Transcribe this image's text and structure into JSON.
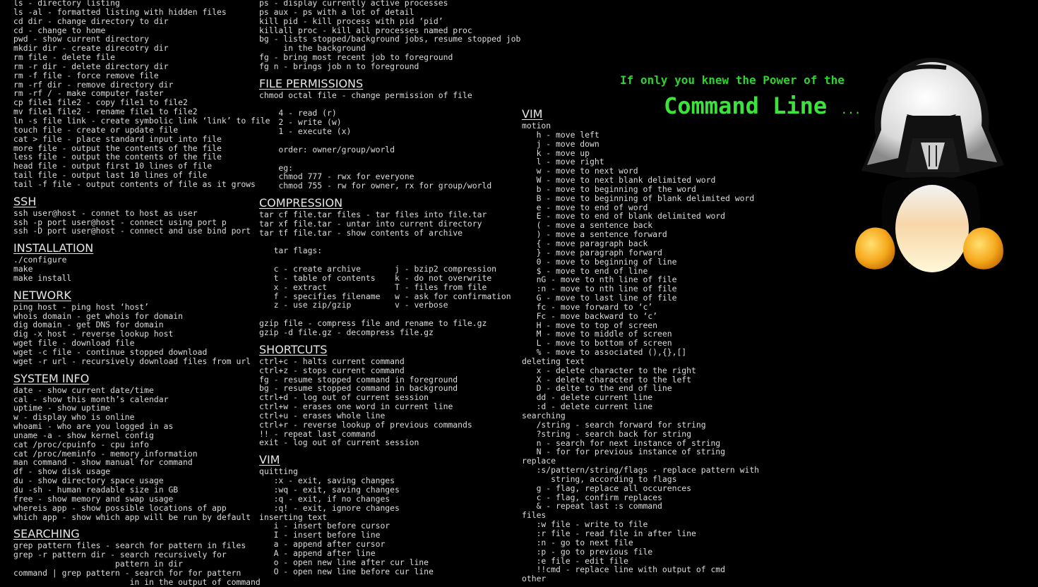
{
  "header": {
    "tagline": "If only you knew the Power of the",
    "title": "Command Line",
    "title_suffix": "..."
  },
  "col1": [
    {
      "kind": "line",
      "text": "ls - directory listing"
    },
    {
      "kind": "line",
      "text": "ls -al - formatted listing with hidden files"
    },
    {
      "kind": "line",
      "text": "cd dir - change directory to dir"
    },
    {
      "kind": "line",
      "text": "cd - change to home"
    },
    {
      "kind": "line",
      "text": "pwd - show current directory"
    },
    {
      "kind": "line",
      "text": "mkdir dir - create direcotry dir"
    },
    {
      "kind": "line",
      "text": "rm file - delete file"
    },
    {
      "kind": "line",
      "text": "rm -r dir - delete directory dir"
    },
    {
      "kind": "line",
      "text": "rm -f file - force remove file"
    },
    {
      "kind": "line",
      "text": "rm -rf dir - remove directory dir"
    },
    {
      "kind": "line",
      "text": "rm -rf / - make computer faster"
    },
    {
      "kind": "line",
      "text": "cp file1 file2 - copy file1 to file2"
    },
    {
      "kind": "line",
      "text": "mv file1 file2 - rename file1 to file2"
    },
    {
      "kind": "line",
      "text": "ln -s file link - create symbolic link ‘link’ to file"
    },
    {
      "kind": "line",
      "text": "touch file - create or update file"
    },
    {
      "kind": "line",
      "text": "cat > file - place standard input into file"
    },
    {
      "kind": "line",
      "text": "more file - output the contents of the file"
    },
    {
      "kind": "line",
      "text": "less file - output the contents of the file"
    },
    {
      "kind": "line",
      "text": "head file - output first 10 lines of file"
    },
    {
      "kind": "line",
      "text": "tail file - output last 10 lines of file"
    },
    {
      "kind": "line",
      "text": "tail -f file - output contents of file as it grows"
    },
    {
      "kind": "head",
      "text": "SSH"
    },
    {
      "kind": "line",
      "text": "ssh user@host - connet to host as user"
    },
    {
      "kind": "line",
      "text": "ssh -p port user@host - connect using port p"
    },
    {
      "kind": "line",
      "text": "ssh -D port user@host - connect and use bind port"
    },
    {
      "kind": "head",
      "text": "INSTALLATION"
    },
    {
      "kind": "line",
      "text": "./configure"
    },
    {
      "kind": "line",
      "text": "make"
    },
    {
      "kind": "line",
      "text": "make install"
    },
    {
      "kind": "head",
      "text": "NETWORK"
    },
    {
      "kind": "line",
      "text": "ping host - ping host ‘host’"
    },
    {
      "kind": "line",
      "text": "whois domain - get whois for domain"
    },
    {
      "kind": "line",
      "text": "dig domain - get DNS for domain"
    },
    {
      "kind": "line",
      "text": "dig -x host - reverse lookup host"
    },
    {
      "kind": "line",
      "text": "wget file - download file"
    },
    {
      "kind": "line",
      "text": "wget -c file - continue stopped download"
    },
    {
      "kind": "line",
      "text": "wget -r url - recursively download files from url"
    },
    {
      "kind": "head",
      "text": "SYSTEM INFO"
    },
    {
      "kind": "line",
      "text": "date - show current date/time"
    },
    {
      "kind": "line",
      "text": "cal - show this month’s calendar"
    },
    {
      "kind": "line",
      "text": "uptime - show uptime"
    },
    {
      "kind": "line",
      "text": "w - display who is online"
    },
    {
      "kind": "line",
      "text": "whoami - who are you logged in as"
    },
    {
      "kind": "line",
      "text": "uname -a - show kernel config"
    },
    {
      "kind": "line",
      "text": "cat /proc/cpuinfo - cpu info"
    },
    {
      "kind": "line",
      "text": "cat /proc/meminfo - memory information"
    },
    {
      "kind": "line",
      "text": "man command - show manual for command"
    },
    {
      "kind": "line",
      "text": "df - show disk usage"
    },
    {
      "kind": "line",
      "text": "du - show directory space usage"
    },
    {
      "kind": "line",
      "text": "du -sh - human readable size in GB"
    },
    {
      "kind": "line",
      "text": "free - show memory and swap usage"
    },
    {
      "kind": "line",
      "text": "whereis app - show possible locations of app"
    },
    {
      "kind": "line",
      "text": "which app - show which app will be run by default"
    },
    {
      "kind": "head",
      "text": "SEARCHING"
    },
    {
      "kind": "line",
      "text": "grep pattern files - search for pattern in files"
    },
    {
      "kind": "line",
      "text": "grep -r pattern dir - search recursively for"
    },
    {
      "kind": "line",
      "text": "                     pattern in dir"
    },
    {
      "kind": "line",
      "text": "command | grep pattern - search for for pattern"
    },
    {
      "kind": "line",
      "text": "                        in in the output of command"
    }
  ],
  "col2": [
    {
      "kind": "line",
      "text": "ps - display currently active processes"
    },
    {
      "kind": "line",
      "text": "ps aux - ps with a lot of detail"
    },
    {
      "kind": "line",
      "text": "kill pid - kill process with pid ‘pid’"
    },
    {
      "kind": "line",
      "text": "killall proc - kill all processes named proc"
    },
    {
      "kind": "line",
      "text": "bg - lists stopped/background jobs, resume stopped job"
    },
    {
      "kind": "line",
      "text": "     in the background"
    },
    {
      "kind": "line",
      "text": "fg - bring most recent job to foreground"
    },
    {
      "kind": "line",
      "text": "fg n - brings job n to foreground"
    },
    {
      "kind": "head",
      "text": "FILE PERMISSIONS"
    },
    {
      "kind": "line",
      "text": "chmod octal file - change permission of file"
    },
    {
      "kind": "gap",
      "text": ""
    },
    {
      "kind": "line",
      "text": "    4 - read (r)"
    },
    {
      "kind": "line",
      "text": "    2 - write (w)"
    },
    {
      "kind": "line",
      "text": "    1 - execute (x)"
    },
    {
      "kind": "gap",
      "text": ""
    },
    {
      "kind": "line",
      "text": "    order: owner/group/world"
    },
    {
      "kind": "gap",
      "text": ""
    },
    {
      "kind": "line",
      "text": "    eg:"
    },
    {
      "kind": "line",
      "text": "    chmod 777 - rwx for everyone"
    },
    {
      "kind": "line",
      "text": "    chmod 755 - rw for owner, rx for group/world"
    },
    {
      "kind": "head",
      "text": "COMPRESSION"
    },
    {
      "kind": "line",
      "text": "tar cf file.tar files - tar files into file.tar"
    },
    {
      "kind": "line",
      "text": "tar xf file.tar - untar into current directory"
    },
    {
      "kind": "line",
      "text": "tar tf file.tar - show contents of archive"
    },
    {
      "kind": "gap",
      "text": ""
    },
    {
      "kind": "line",
      "text": "   tar flags:"
    },
    {
      "kind": "gap",
      "text": ""
    },
    {
      "kind": "line",
      "text": "   c - create archive       j - bzip2 compression"
    },
    {
      "kind": "line",
      "text": "   t - table of contents    k - do not overwrite"
    },
    {
      "kind": "line",
      "text": "   x - extract              T - files from file"
    },
    {
      "kind": "line",
      "text": "   f - specifies filename   w - ask for confirmation"
    },
    {
      "kind": "line",
      "text": "   z - use zip/gzip         v - verbose"
    },
    {
      "kind": "gap",
      "text": ""
    },
    {
      "kind": "line",
      "text": "gzip file - compress file and rename to file.gz"
    },
    {
      "kind": "line",
      "text": "gzip -d file.gz - decompress file.gz"
    },
    {
      "kind": "head",
      "text": "SHORTCUTS"
    },
    {
      "kind": "line",
      "text": "ctrl+c - halts current command"
    },
    {
      "kind": "line",
      "text": "ctrl+z - stops current command"
    },
    {
      "kind": "line",
      "text": "fg - resume stopped command in foreground"
    },
    {
      "kind": "line",
      "text": "bg - resume stopped command in background"
    },
    {
      "kind": "line",
      "text": "ctrl+d - log out of current session"
    },
    {
      "kind": "line",
      "text": "ctrl+w - erases one word in current line"
    },
    {
      "kind": "line",
      "text": "ctrl+u - erases whole line"
    },
    {
      "kind": "line",
      "text": "ctrl+r - reverse lookup of previous commands"
    },
    {
      "kind": "line",
      "text": "!! - repeat last command"
    },
    {
      "kind": "line",
      "text": "exit - log out of current session"
    },
    {
      "kind": "head",
      "text": "VIM"
    },
    {
      "kind": "line",
      "text": "quitting"
    },
    {
      "kind": "line",
      "text": "   :x - exit, saving changes"
    },
    {
      "kind": "line",
      "text": "   :wq - exit, saving changes"
    },
    {
      "kind": "line",
      "text": "   :q - exit, if no changes"
    },
    {
      "kind": "line",
      "text": "   :q! - exit, ignore changes"
    },
    {
      "kind": "line",
      "text": "inserting text"
    },
    {
      "kind": "line",
      "text": "   i - insert before cursor"
    },
    {
      "kind": "line",
      "text": "   I - insert before line"
    },
    {
      "kind": "line",
      "text": "   a - append after cursor"
    },
    {
      "kind": "line",
      "text": "   A - append after line"
    },
    {
      "kind": "line",
      "text": "   o - open new line after cur line"
    },
    {
      "kind": "line",
      "text": "   O - open new line before cur line"
    }
  ],
  "col3": [
    {
      "kind": "head",
      "text": "VIM"
    },
    {
      "kind": "line",
      "text": "motion"
    },
    {
      "kind": "line",
      "text": "   h - move left"
    },
    {
      "kind": "line",
      "text": "   j - move down"
    },
    {
      "kind": "line",
      "text": "   k - move up"
    },
    {
      "kind": "line",
      "text": "   l - move right"
    },
    {
      "kind": "line",
      "text": "   w - move to next word"
    },
    {
      "kind": "line",
      "text": "   W - move to next blank delimited word"
    },
    {
      "kind": "line",
      "text": "   b - move to beginning of the word"
    },
    {
      "kind": "line",
      "text": "   B - move to beginning of blank delimited word"
    },
    {
      "kind": "line",
      "text": "   e - move to end of word"
    },
    {
      "kind": "line",
      "text": "   E - move to end of blank delimited word"
    },
    {
      "kind": "line",
      "text": "   ( - move a sentence back"
    },
    {
      "kind": "line",
      "text": "   ) - move a sentence forward"
    },
    {
      "kind": "line",
      "text": "   { - move paragraph back"
    },
    {
      "kind": "line",
      "text": "   } - move paragraph forward"
    },
    {
      "kind": "line",
      "text": "   0 - move to beginning of line"
    },
    {
      "kind": "line",
      "text": "   $ - move to end of line"
    },
    {
      "kind": "line",
      "text": "   nG - move to nth line of file"
    },
    {
      "kind": "line",
      "text": "   :n - move to nth line of file"
    },
    {
      "kind": "line",
      "text": "   G - move to last line of file"
    },
    {
      "kind": "line",
      "text": "   fc - move forward to ‘c’"
    },
    {
      "kind": "line",
      "text": "   Fc - move backward to ‘c’"
    },
    {
      "kind": "line",
      "text": "   H - move to top of screen"
    },
    {
      "kind": "line",
      "text": "   M - move to middle of screen"
    },
    {
      "kind": "line",
      "text": "   L - move to bottom of screen"
    },
    {
      "kind": "line",
      "text": "   % - move to associated (),{},[]"
    },
    {
      "kind": "line",
      "text": "deleting text"
    },
    {
      "kind": "line",
      "text": "   x - delete character to the right"
    },
    {
      "kind": "line",
      "text": "   X - delete character to the left"
    },
    {
      "kind": "line",
      "text": "   D - delte to the end of line"
    },
    {
      "kind": "line",
      "text": "   dd - delete current line"
    },
    {
      "kind": "line",
      "text": "   :d - delete current line"
    },
    {
      "kind": "line",
      "text": "searching"
    },
    {
      "kind": "line",
      "text": "   /string - search forward for string"
    },
    {
      "kind": "line",
      "text": "   ?string - search back for string"
    },
    {
      "kind": "line",
      "text": "   n - search for next instance of string"
    },
    {
      "kind": "line",
      "text": "   N - for for previous instance of string"
    },
    {
      "kind": "line",
      "text": "replace"
    },
    {
      "kind": "line",
      "text": "   :s/pattern/string/flags - replace pattern with"
    },
    {
      "kind": "line",
      "text": "      string, according to flags"
    },
    {
      "kind": "line",
      "text": "   g - flag, replace all occurences"
    },
    {
      "kind": "line",
      "text": "   c - flag, confirm replaces"
    },
    {
      "kind": "line",
      "text": "   & - repeat last :s command"
    },
    {
      "kind": "line",
      "text": "files"
    },
    {
      "kind": "line",
      "text": "   :w file - write to file"
    },
    {
      "kind": "line",
      "text": "   :r file - read file in after line"
    },
    {
      "kind": "line",
      "text": "   :n - go to next file"
    },
    {
      "kind": "line",
      "text": "   :p - go to previous file"
    },
    {
      "kind": "line",
      "text": "   :e file - edit file"
    },
    {
      "kind": "line",
      "text": "   !!cmd - replace line with output of cmd"
    },
    {
      "kind": "line",
      "text": "other"
    }
  ],
  "mascot": {
    "icon": "darth-vader-tux-icon"
  }
}
